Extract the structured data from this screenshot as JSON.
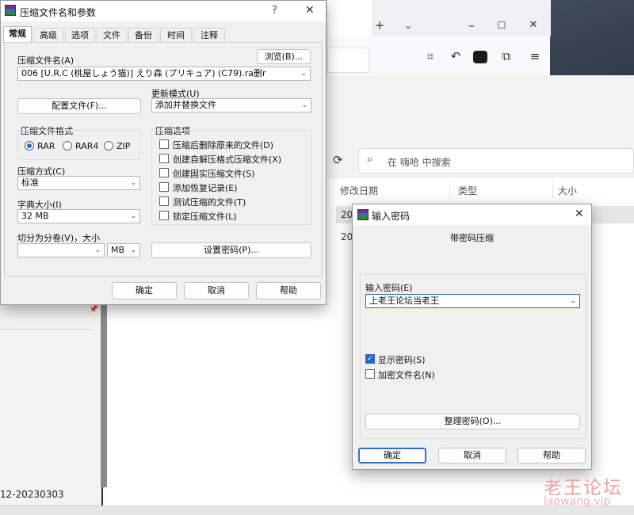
{
  "explorer": {
    "search_placeholder": "在 嗨哈 中搜索",
    "columns": [
      "修改日期",
      "类型",
      "大小"
    ],
    "rows": [
      "20",
      "20"
    ],
    "footer_text": "12-20230303"
  },
  "archive_dialog": {
    "title": "压缩文件名和参数",
    "help_glyph": "?",
    "close_glyph": "✕",
    "tabs": [
      "常规",
      "高级",
      "选项",
      "文件",
      "备份",
      "时间",
      "注释"
    ],
    "archive_name_label": "压缩文件名(A)",
    "browse_button": "浏览(B)...",
    "archive_name_value": "006   [U.R.C (桃屋しょう猫)] えり森 (プリキュア) (C79).ra删r",
    "profiles_button": "配置文件(F)...",
    "update_mode_label": "更新模式(U)",
    "update_mode_value": "添加并替换文件",
    "format_group_label": "压缩文件格式",
    "formats": [
      "RAR",
      "RAR4",
      "ZIP"
    ],
    "selected_format": "RAR",
    "options_group_label": "压缩选项",
    "options": [
      {
        "label": "压缩后删除原来的文件(D)",
        "checked": false
      },
      {
        "label": "创建自解压格式压缩文件(X)",
        "checked": false
      },
      {
        "label": "创建固实压缩文件(S)",
        "checked": false
      },
      {
        "label": "添加恢复记录(E)",
        "checked": false
      },
      {
        "label": "测试压缩的文件(T)",
        "checked": false
      },
      {
        "label": "锁定压缩文件(L)",
        "checked": false
      }
    ],
    "method_label": "压缩方式(C)",
    "method_value": "标准",
    "dict_label": "字典大小(I)",
    "dict_value": "32 MB",
    "split_label": "切分为分卷(V)，大小",
    "split_value": "",
    "split_unit": "MB",
    "set_password_button": "设置密码(P)...",
    "ok_button": "确定",
    "cancel_button": "取消",
    "help_button": "帮助"
  },
  "password_dialog": {
    "title": "输入密码",
    "close_glyph": "✕",
    "subtitle": "带密码压缩",
    "password_label": "输入密码(E)",
    "password_value": "上老王论坛当老王",
    "show_password_label": "显示密码(S)",
    "show_password_checked": true,
    "encrypt_names_label": "加密文件名(N)",
    "encrypt_names_checked": false,
    "organize_button": "整理密码(O)...",
    "ok_button": "确定",
    "cancel_button": "取消",
    "help_button": "帮助"
  },
  "watermark": {
    "text_cn": "老王论坛",
    "text_en": "laowang.vip"
  },
  "icons": {
    "browser": [
      "tab-add-icon",
      "tab-list-icon",
      "minimize-icon",
      "maximize-icon",
      "close-icon",
      "crop-icon",
      "undo-icon",
      "extension-icon",
      "puzzle-icon",
      "menu-icon"
    ],
    "explorer": [
      "refresh-icon",
      "search-icon",
      "pin-icon"
    ]
  },
  "colors": {
    "accent": "#2a66c3",
    "watermark": "#f0a0a0"
  }
}
